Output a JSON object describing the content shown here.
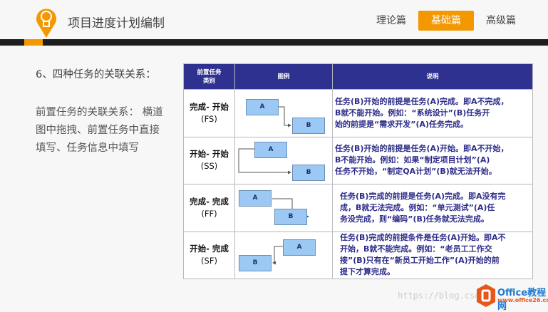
{
  "header": {
    "title": "项目进度计划编制",
    "tabs": [
      {
        "label": "理论篇"
      },
      {
        "label": "基础篇",
        "active": true
      },
      {
        "label": "高级篇"
      }
    ]
  },
  "colors": {
    "accent": "#f39800",
    "table_header": "#2f3190",
    "desc_text": "#2d2d8a",
    "box_fill": "#9cc9f4"
  },
  "left": {
    "heading": "6、四种任务的关联关系：",
    "lines": [
      "前置任务的关联关系： 横道",
      "图中拖拽、前置任务中直接",
      "填写、任务信息中填写"
    ]
  },
  "table": {
    "headers": {
      "type_line1": "前置任务",
      "type_line2": "类别",
      "legend": "图例",
      "desc": "说明"
    },
    "rows": [
      {
        "type": "完成- 开始",
        "code": "(FS)",
        "box_a": "A",
        "box_b": "B",
        "desc": [
          "任务(B)开始的前提是任务(A)完成。即A不完成，",
          "B就不能开始。例如：“系统设计”(B)任务开",
          "始的前提是“需求开发”(A)任务完成。"
        ]
      },
      {
        "type": "开始- 开始",
        "code": "(SS)",
        "box_a": "A",
        "box_b": "B",
        "desc": [
          "任务(B)开始的前提是任务(A)开始。即A不开始，",
          "B不能开始。例如：如果“制定项目计划”(A)",
          "任务不开始，“制定QA计划”(B)就无法开始。"
        ]
      },
      {
        "type": "完成- 完成",
        "code": "(FF)",
        "box_a": "A",
        "box_b": "B",
        "desc": [
          "任务(B)完成的前提是任务(A)完成。即A没有完",
          "成，B就无法完成。例如：“单元测试”(A)任",
          "务没完成，则“编码”(B)任务就无法完成。"
        ]
      },
      {
        "type": "开始- 完成",
        "code": "(SF)",
        "box_a": "A",
        "box_b": "B",
        "desc": [
          "任务(B)完成的前提条件是任务(A)开始。即A不",
          "开始，B就不能完成。例如：“老员工工作交",
          "接”(B)只有在“新员工开始工作”(A)开始的前",
          "提下才算完成。"
        ]
      }
    ]
  },
  "watermark": "https://blog.csdn.n",
  "brand": {
    "name": "Office教程网",
    "url": "www.office26.com"
  }
}
